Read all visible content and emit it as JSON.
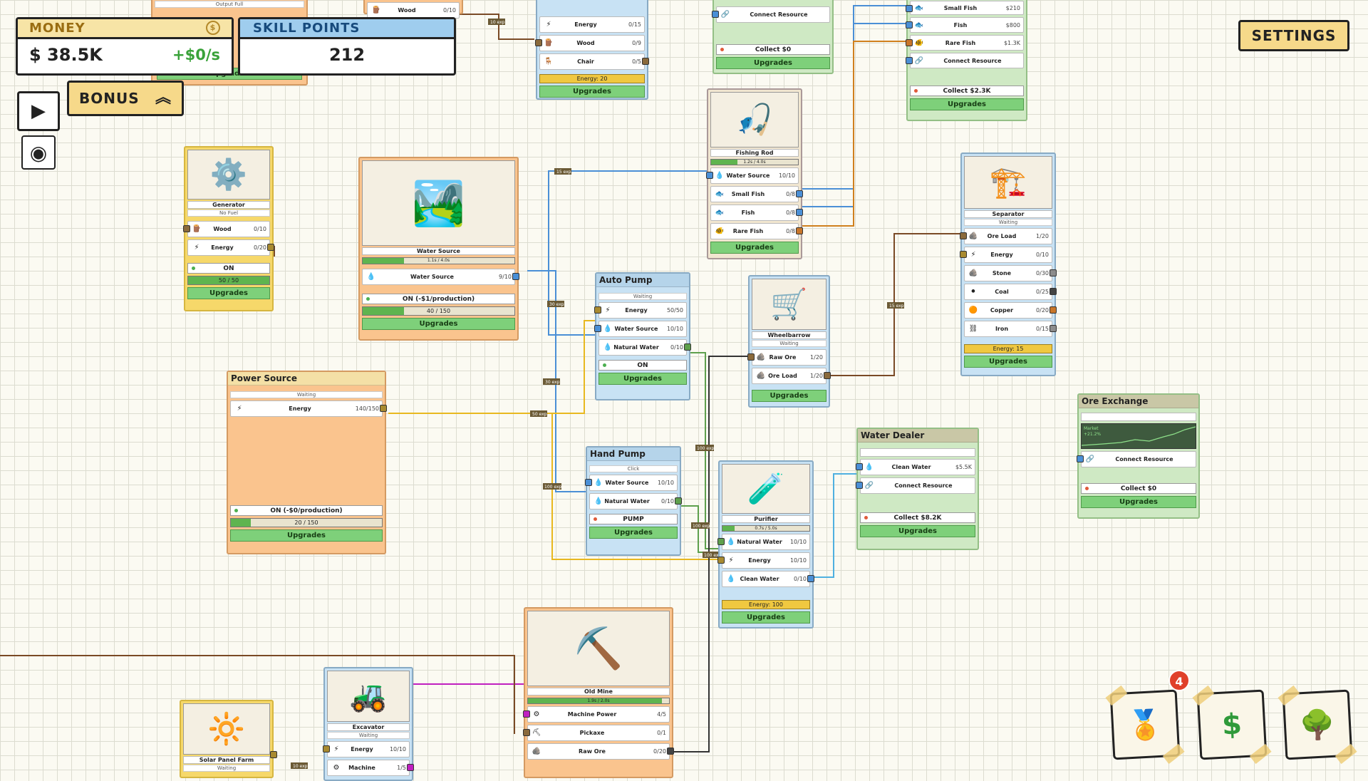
{
  "hud": {
    "money": {
      "title": "MONEY",
      "amount": "$ 38.5K",
      "rate": "+$0/s",
      "coin_icon": "$"
    },
    "skill_points": {
      "title": "SKILL POINTS",
      "value": "212"
    },
    "bonus_label": "BONUS",
    "settings_label": "SETTINGS",
    "play_icon": "▶",
    "record_icon": "◉",
    "badge_count": "4",
    "achievements_icon": "🏅",
    "shop_icon": "$",
    "skilltree_icon": "🌳"
  },
  "colors": {
    "accent_blue": "#4a8fd6",
    "accent_yellow": "#e8b820",
    "accent_green": "#5fb44f",
    "wire_brown": "#7a4a26",
    "wire_orange": "#d0801e",
    "wire_magenta": "#c020c0"
  },
  "nodes": {
    "top_left_partial": {
      "sub": "Output Full",
      "upgrades": "Upgrades"
    },
    "top_wood_partial": {
      "label": "Wood",
      "val": "0/10"
    },
    "top_chair_maker": {
      "rows": [
        {
          "icon": "⚡",
          "label": "Energy",
          "val": "0/15"
        },
        {
          "icon": "🪵",
          "label": "Wood",
          "val": "0/9"
        },
        {
          "icon": "🪑",
          "label": "Chair",
          "val": "0/5"
        }
      ],
      "energy": "Energy: 20",
      "upgrades": "Upgrades"
    },
    "top_market_partial": {
      "connect": "Connect Resource",
      "collect": "Collect $0",
      "upgrades": "Upgrades"
    },
    "fish_market": {
      "rows": [
        {
          "icon": "🐟",
          "label": "Small Fish",
          "val": "$210"
        },
        {
          "icon": "🐟",
          "label": "Fish",
          "val": "$800"
        },
        {
          "icon": "🐠",
          "label": "Rare Fish",
          "val": "$1.3K"
        },
        {
          "icon": "🔗",
          "label": "Connect Resource",
          "val": ""
        }
      ],
      "collect": "Collect $2.3K",
      "upgrades": "Upgrades"
    },
    "generator": {
      "art": "⚙️",
      "name": "Generator",
      "sub": "No Fuel",
      "rows": [
        {
          "icon": "🪵",
          "label": "Wood",
          "val": "0/10"
        },
        {
          "icon": "⚡",
          "label": "Energy",
          "val": "0/20"
        }
      ],
      "status": "ON",
      "bar_text": "50 / 50",
      "bar_fill": 1.0,
      "upgrades": "Upgrades"
    },
    "water_source": {
      "art": "🏞️",
      "name": "Water Source",
      "progress": "1.1s / 4.0s",
      "progress_fill": 0.27,
      "rows": [
        {
          "icon": "💧",
          "label": "Water Source",
          "val": "9/10"
        }
      ],
      "status": "ON (-$1/production)",
      "bar_text": "40 / 150",
      "bar_fill": 0.27,
      "upgrades": "Upgrades"
    },
    "fishing_rod": {
      "art": "🎣",
      "name": "Fishing Rod",
      "progress": "1.2s / 4.0s",
      "progress_fill": 0.3,
      "rows": [
        {
          "icon": "💧",
          "label": "Water Source",
          "val": "10/10"
        },
        {
          "icon": "🐟",
          "label": "Small Fish",
          "val": "0/8"
        },
        {
          "icon": "🐟",
          "label": "Fish",
          "val": "0/8"
        },
        {
          "icon": "🐠",
          "label": "Rare Fish",
          "val": "0/8"
        }
      ],
      "upgrades": "Upgrades"
    },
    "separator": {
      "art": "🏗️",
      "name": "Separator",
      "sub": "Waiting",
      "rows": [
        {
          "icon": "🪨",
          "label": "Ore Load",
          "val": "1/20"
        },
        {
          "icon": "⚡",
          "label": "Energy",
          "val": "0/10"
        },
        {
          "icon": "🪨",
          "label": "Stone",
          "val": "0/30"
        },
        {
          "icon": "⚫",
          "label": "Coal",
          "val": "0/25"
        },
        {
          "icon": "🟠",
          "label": "Copper",
          "val": "0/20"
        },
        {
          "icon": "⛓",
          "label": "Iron",
          "val": "0/15"
        }
      ],
      "energy": "Energy: 15",
      "upgrades": "Upgrades"
    },
    "auto_pump": {
      "title": "Auto Pump",
      "sub": "Waiting",
      "rows": [
        {
          "icon": "⚡",
          "label": "Energy",
          "val": "50/50"
        },
        {
          "icon": "💧",
          "label": "Water Source",
          "val": "10/10"
        },
        {
          "icon": "💧",
          "label": "Natural Water",
          "val": "0/10"
        }
      ],
      "status": "ON",
      "upgrades": "Upgrades"
    },
    "wheelbarrow": {
      "art": "🛒",
      "name": "Wheelbarrow",
      "sub": "Waiting",
      "rows": [
        {
          "icon": "🪨",
          "label": "Raw Ore",
          "val": "1/20"
        },
        {
          "icon": "🪨",
          "label": "Ore Load",
          "val": "1/20"
        }
      ],
      "upgrades": "Upgrades"
    },
    "power_source": {
      "title": "Power Source",
      "sub": "Waiting",
      "rows": [
        {
          "icon": "⚡",
          "label": "Energy",
          "val": "140/150"
        }
      ],
      "status": "ON (-$0/production)",
      "bar_text": "20 / 150",
      "bar_fill": 0.13,
      "upgrades": "Upgrades"
    },
    "hand_pump": {
      "title": "Hand Pump",
      "sub": "Click",
      "rows": [
        {
          "icon": "💧",
          "label": "Water Source",
          "val": "10/10"
        },
        {
          "icon": "💧",
          "label": "Natural Water",
          "val": "0/10"
        }
      ],
      "action": "PUMP",
      "upgrades": "Upgrades"
    },
    "purifier": {
      "art": "🧪",
      "name": "Purifier",
      "progress": "0.7s / 5.0s",
      "progress_fill": 0.14,
      "rows": [
        {
          "icon": "💧",
          "label": "Natural Water",
          "val": "10/10"
        },
        {
          "icon": "⚡",
          "label": "Energy",
          "val": "10/10"
        },
        {
          "icon": "💧",
          "label": "Clean Water",
          "val": "0/10"
        }
      ],
      "energy": "Energy: 100",
      "upgrades": "Upgrades"
    },
    "water_dealer": {
      "title": "Water Dealer",
      "rows": [
        {
          "icon": "💧",
          "label": "Clean Water",
          "val": "$5.5K"
        },
        {
          "icon": "🔗",
          "label": "Connect Resource",
          "val": ""
        }
      ],
      "collect": "Collect $8.2K",
      "upgrades": "Upgrades"
    },
    "ore_exchange": {
      "title": "Ore Exchange",
      "market_label": "Market",
      "market_value": "+21.2%",
      "rows": [
        {
          "icon": "🔗",
          "label": "Connect Resource",
          "val": ""
        }
      ],
      "collect": "Collect $0",
      "upgrades": "Upgrades"
    },
    "old_mine": {
      "art": "⛏️",
      "name": "Old Mine",
      "progress": "1.9s / 2.0s",
      "progress_fill": 0.95,
      "rows": [
        {
          "icon": "⚙",
          "label": "Machine Power",
          "val": "4/5"
        },
        {
          "icon": "⛏",
          "label": "Pickaxe",
          "val": "0/1"
        },
        {
          "icon": "🪨",
          "label": "Raw Ore",
          "val": "0/20"
        }
      ]
    },
    "excavator": {
      "art": "🚜",
      "name": "Excavator",
      "sub": "Waiting",
      "rows": [
        {
          "icon": "⚡",
          "label": "Energy",
          "val": "10/10"
        },
        {
          "icon": "⚙",
          "label": "Machine",
          "val": "1/5"
        }
      ]
    },
    "solar_panel_farm": {
      "art": "🔆",
      "name": "Solar Panel Farm",
      "sub": "Waiting"
    }
  },
  "wire_labels": [
    "10 exp",
    "15 exp",
    "30 exp",
    "30 exp",
    "50 exp",
    "100 exp",
    "100 exp",
    "100 exp",
    "100 exp",
    "10 exp",
    "10 exp"
  ]
}
